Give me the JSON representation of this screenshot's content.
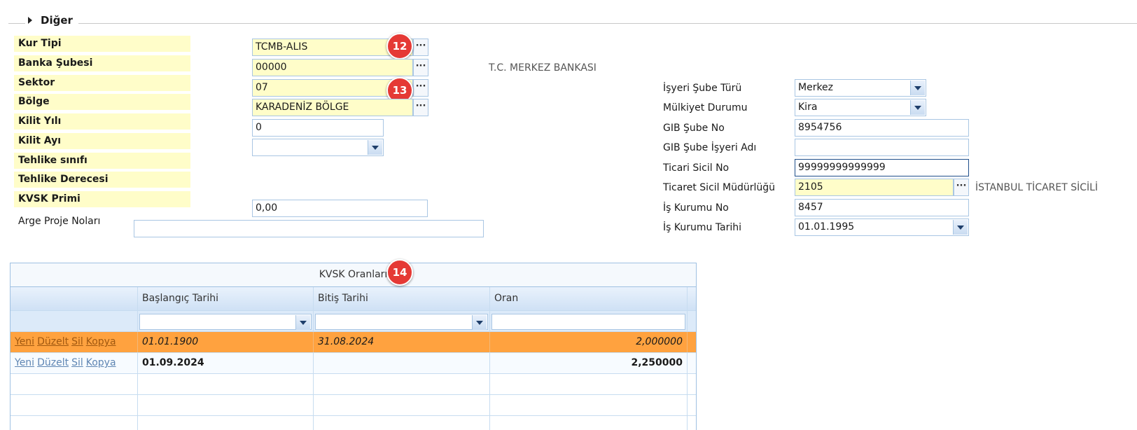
{
  "group": {
    "title": "Diğer"
  },
  "left_labels": {
    "kur_tipi": "Kur Tipi",
    "banka_subesi": "Banka Şubesi",
    "sektor": "Sektor",
    "bolge": "Bölge",
    "kilit_yili": "Kilit Yılı",
    "kilit_ayi": "Kilit Ayı",
    "tehlike_sinifi": "Tehlike sınıfı",
    "tehlike_derecesi": "Tehlike Derecesi",
    "kvsk_primi": "KVSK Primi",
    "arge_proje": "Arge Proje Noları"
  },
  "left_values": {
    "kur_tipi": "TCMB-ALIS",
    "banka_subesi": "00000",
    "banka_subesi_desc": "T.C. MERKEZ BANKASI",
    "sektor": "07",
    "bolge": "KARADENİZ BÖLGE",
    "kilit_yili": "0",
    "kilit_ayi": "",
    "kvsk_primi": "0,00",
    "arge_proje": ""
  },
  "right_labels": {
    "sube_turu": "İşyeri Şube Türü",
    "mulkiyet": "Mülkiyet Durumu",
    "gib_sube_no": "GIB Şube No",
    "gib_isyeri_adi": "GIB Şube İşyeri Adı",
    "ticari_sicil": "Ticari Sicil No",
    "sicil_mudurlugu": "Ticaret Sicil Müdürlüğü",
    "is_kurumu_no": "İş Kurumu No",
    "is_kurumu_tarihi": "İş Kurumu Tarihi"
  },
  "right_values": {
    "sube_turu": "Merkez",
    "mulkiyet": "Kira",
    "gib_sube_no": "8954756",
    "gib_isyeri_adi": "",
    "ticari_sicil": "99999999999999",
    "sicil_mudurlugu": "2105",
    "sicil_mudurlugu_desc": "İSTANBUL TİCARET SİCİLİ",
    "is_kurumu_no": "8457",
    "is_kurumu_tarihi": "01.01.1995"
  },
  "badges": {
    "b12": "12",
    "b13": "13",
    "b14": "14"
  },
  "grid": {
    "title": "KVSK Oranları",
    "columns": [
      "",
      "Başlangıç Tarihi",
      "Bitiş Tarihi",
      "Oran"
    ],
    "row_actions": [
      "Yeni",
      "Düzelt",
      "Sil",
      "Kopya"
    ],
    "rows": [
      {
        "start": "01.01.1900",
        "end": "31.08.2024",
        "rate": "2,000000"
      },
      {
        "start": "01.09.2024",
        "end": "",
        "rate": "2,250000"
      }
    ]
  },
  "colors": {
    "required_bg": "#fffdc9",
    "selected_row": "#ffa23f",
    "badge": "#e53935",
    "border": "#a9c6e3"
  }
}
